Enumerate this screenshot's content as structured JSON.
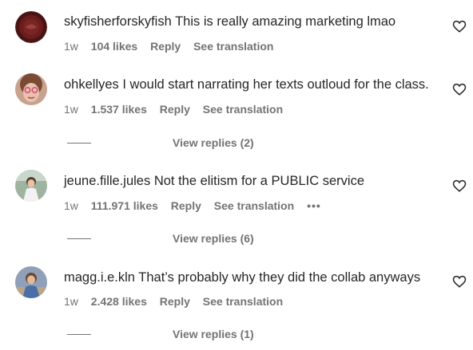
{
  "comments": [
    {
      "username": "skyfisherforskyfish",
      "text": "This is really amazing marketing lmao",
      "age": "1w",
      "likes": "104 likes",
      "reply": "Reply",
      "translate": "See translation"
    },
    {
      "username": "ohkellyes",
      "text": "I would start narrating her texts outloud for the class.",
      "age": "1w",
      "likes": "1.537 likes",
      "reply": "Reply",
      "translate": "See translation",
      "view_replies": "View replies (2)"
    },
    {
      "username": "jeune.fille.jules",
      "text": "Not the elitism for a PUBLIC service",
      "age": "1w",
      "likes": "111.971 likes",
      "reply": "Reply",
      "translate": "See translation",
      "more": "•••",
      "view_replies": "View replies (6)"
    },
    {
      "username": "magg.i.e.kln",
      "text": "That’s probably why they did the collab anyways",
      "age": "1w",
      "likes": "2.428 likes",
      "reply": "Reply",
      "translate": "See translation",
      "view_replies": "View replies (1)"
    }
  ],
  "icons": {
    "like": "heart-icon",
    "more": "more-options-icon"
  },
  "colors": {
    "primary_text": "#262626",
    "secondary_text": "#737373"
  }
}
